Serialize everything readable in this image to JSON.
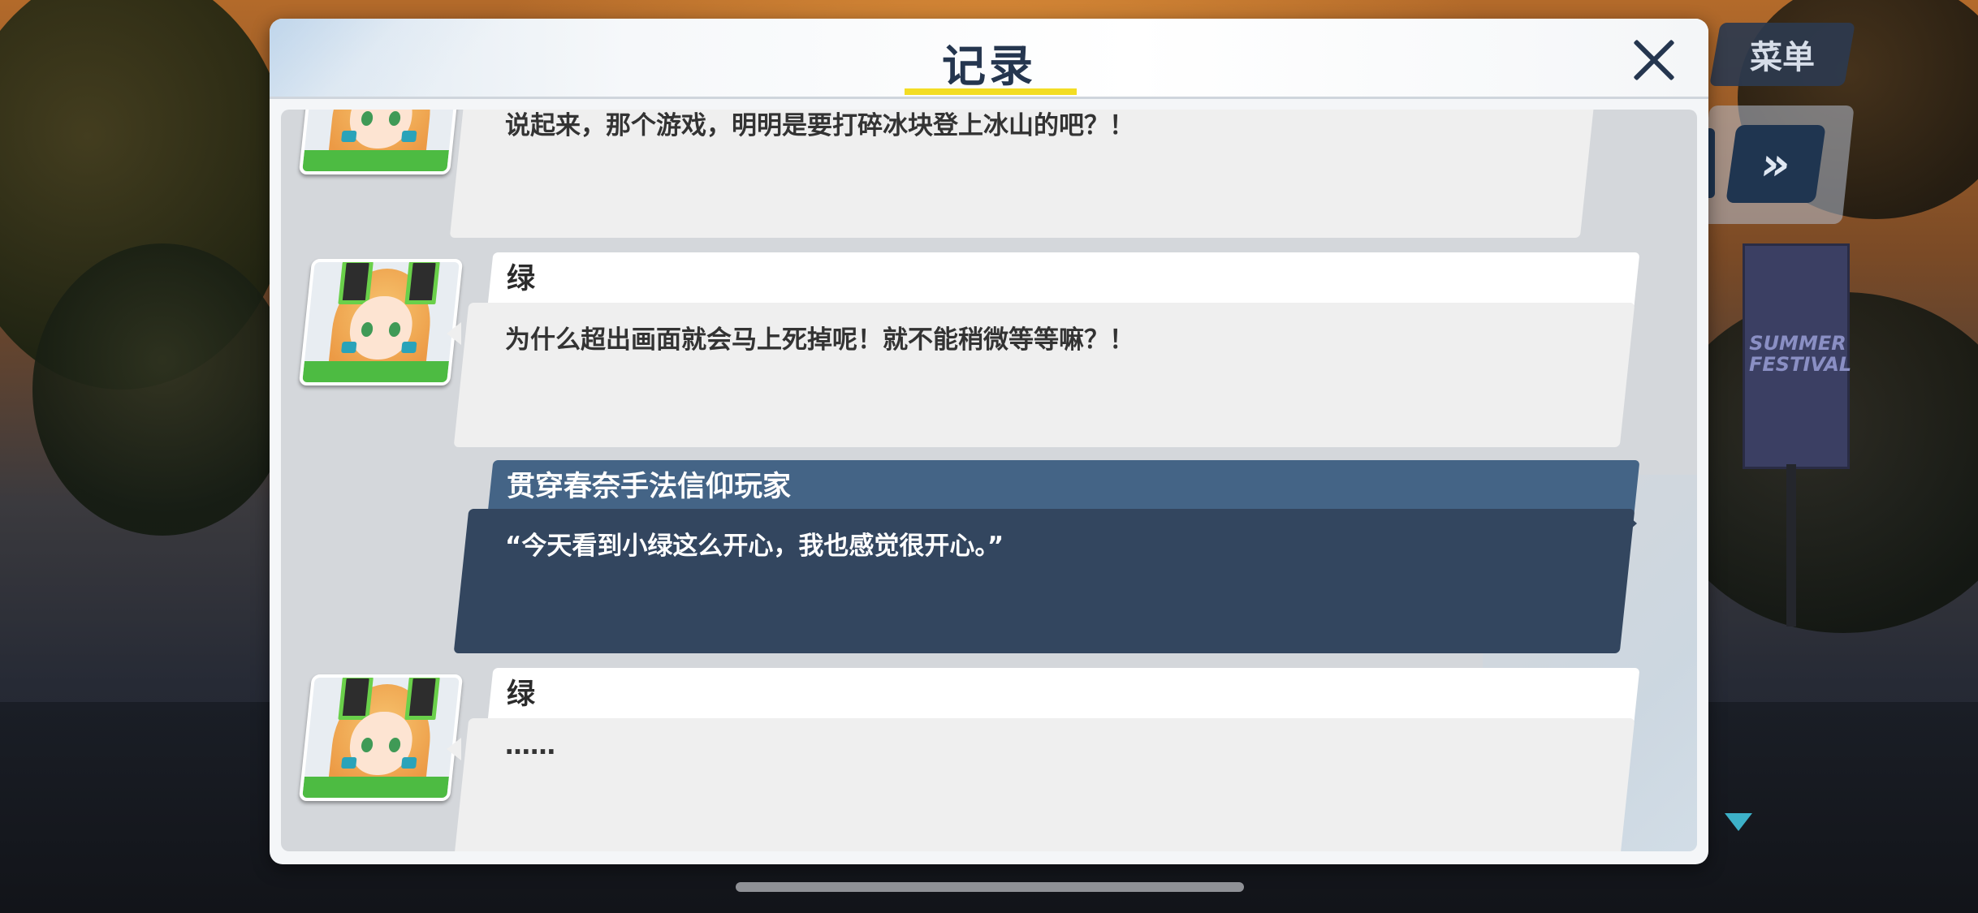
{
  "hud": {
    "menu_label": "菜单",
    "fast_forward_icon": "»",
    "scroll_indicator_color": "#3db1c8"
  },
  "background": {
    "banner_text": "SUMMER FESTIVAL"
  },
  "log": {
    "title": "记录",
    "accent_color": "#f3dd24",
    "entries": [
      {
        "speaker": "",
        "text": "说起来，那个游戏，明明是要打碎冰块登上冰山的吧？！",
        "is_player": false
      },
      {
        "speaker": "绿",
        "text": "为什么超出画面就会马上死掉呢！就不能稍微等等嘛？！",
        "is_player": false
      },
      {
        "speaker": "贯穿春奈手法信仰玩家",
        "text": "“今天看到小绿这么开心，我也感觉很开心。”",
        "is_player": true
      },
      {
        "speaker": "绿",
        "text": "……",
        "is_player": false
      }
    ]
  }
}
